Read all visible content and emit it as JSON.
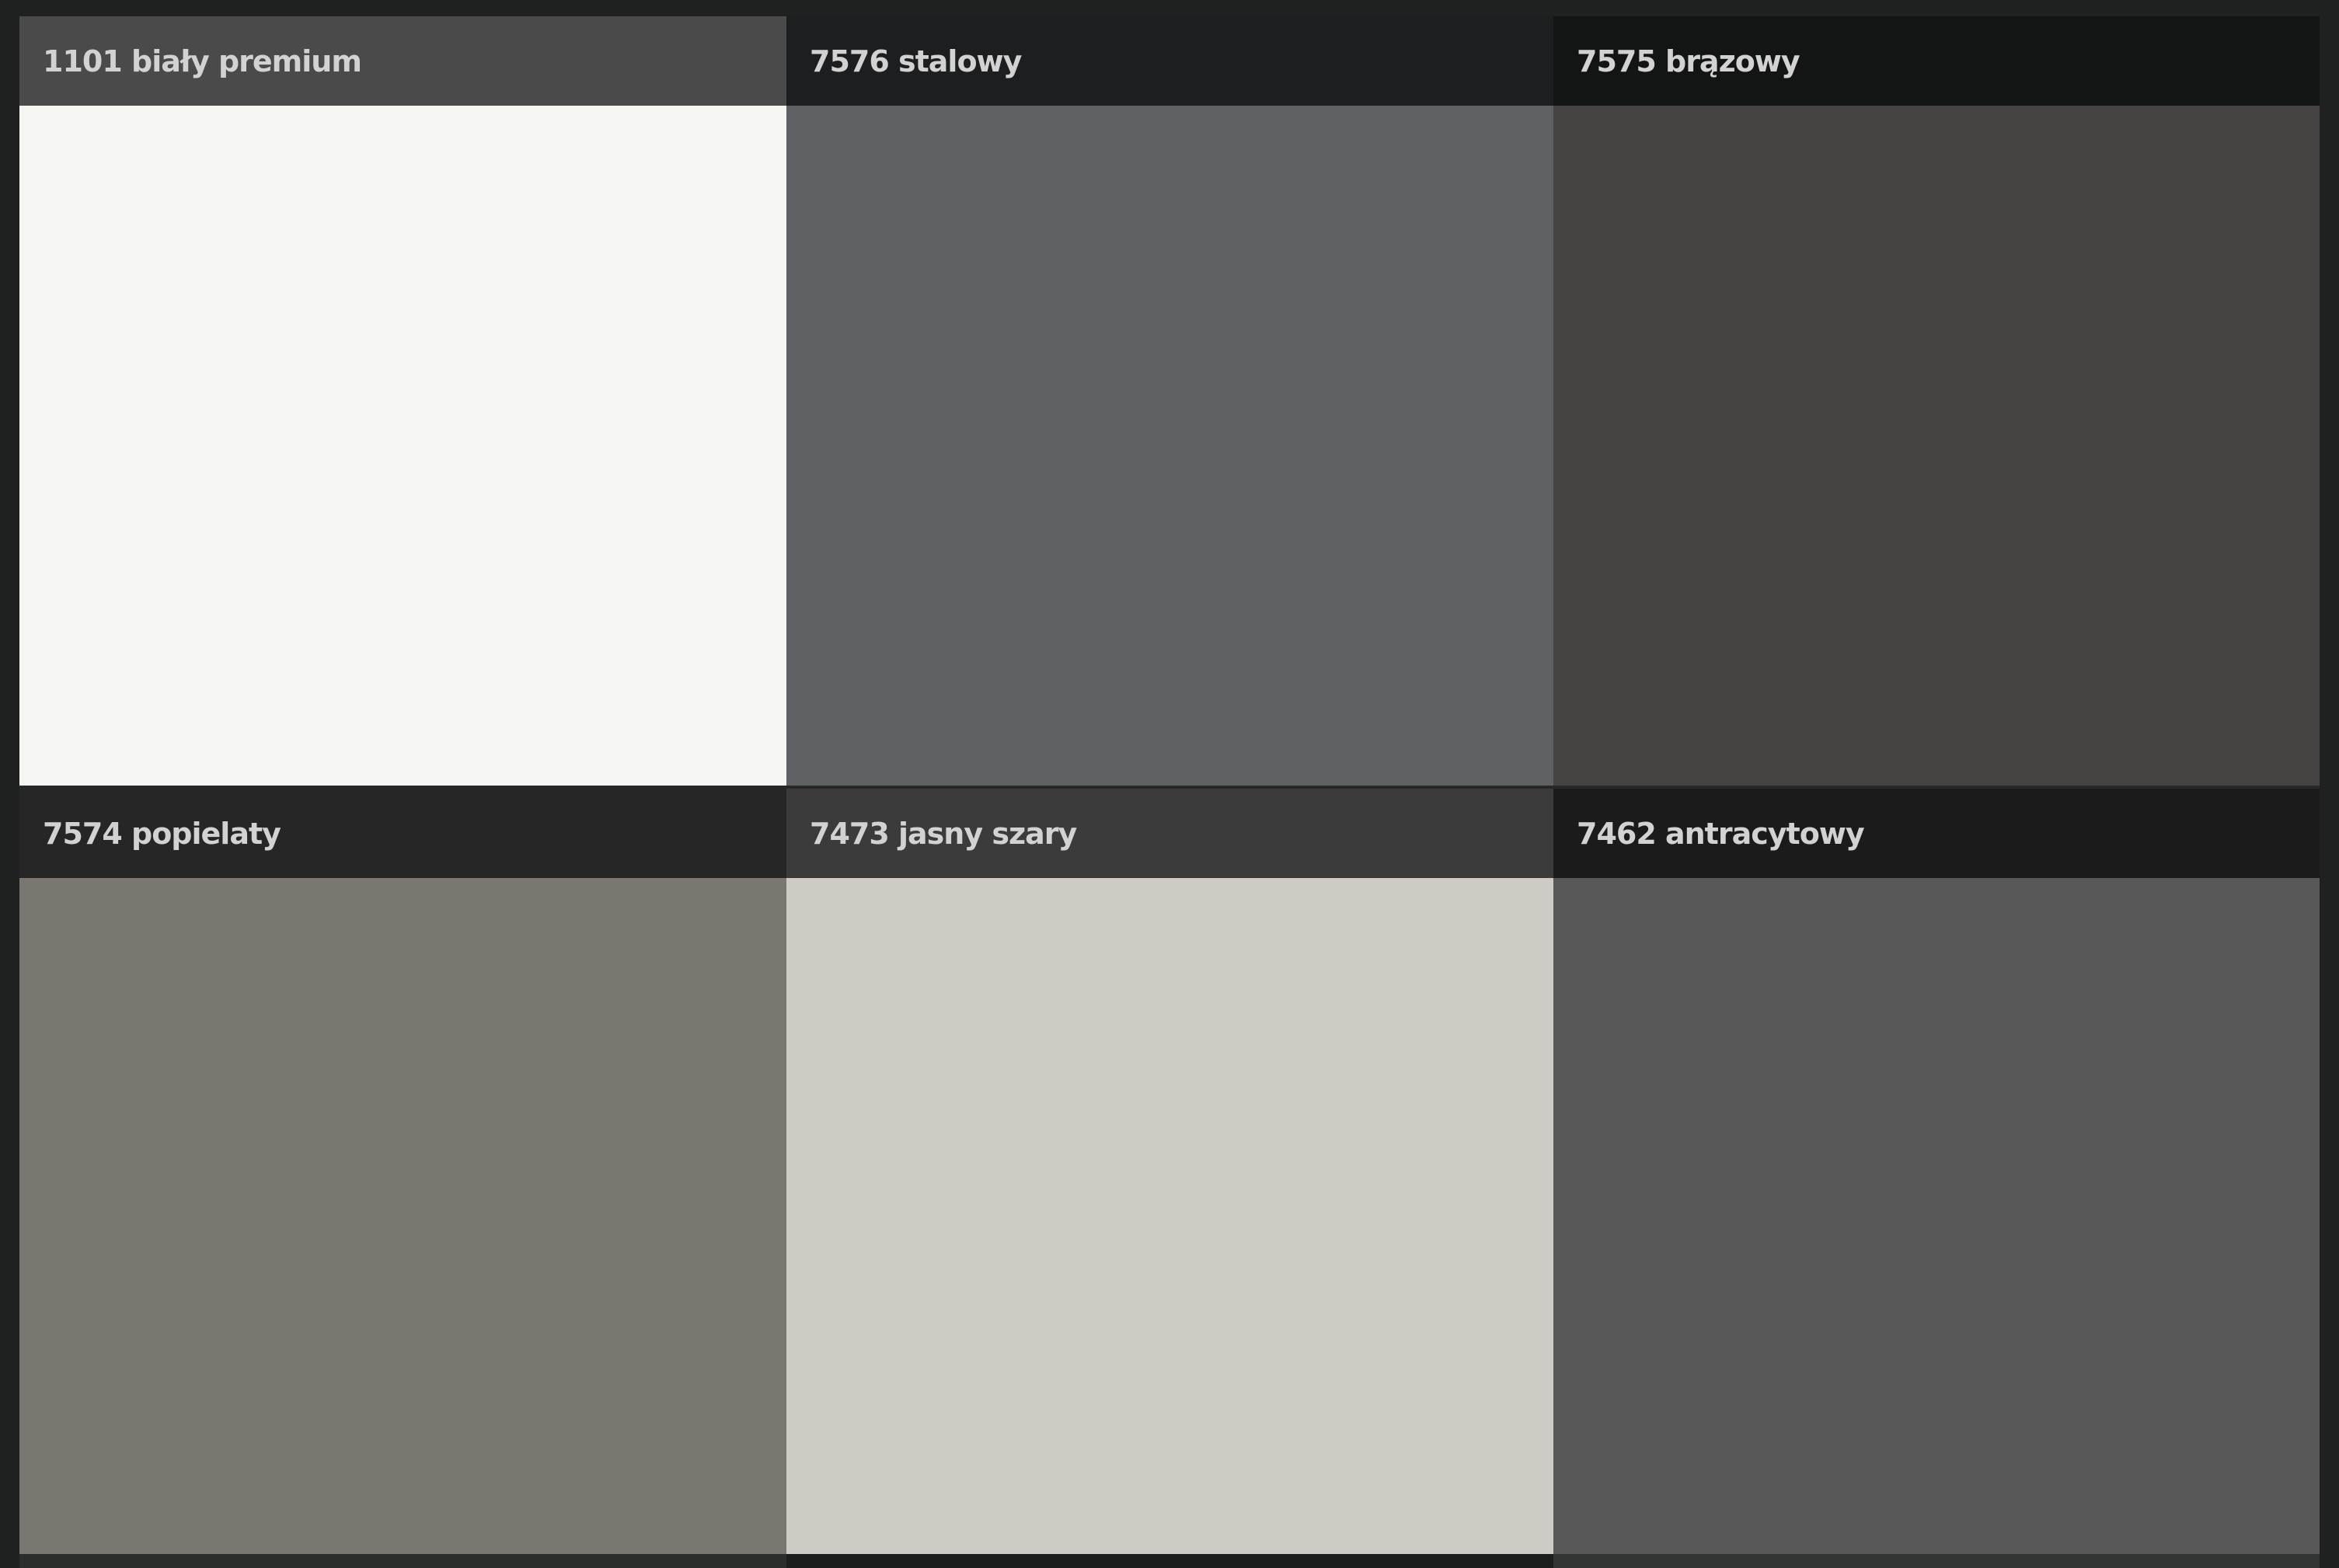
{
  "swatches": [
    {
      "label": "1101 biały premium",
      "header_color": "#4a4a4a",
      "color": "#f5f5f1"
    },
    {
      "label": "7576 stalowy",
      "header_color": "#1d1e1f",
      "color": "#5e6265"
    },
    {
      "label": "7575 brązowy",
      "header_color": "#131414",
      "color": "#474343"
    },
    {
      "label": "7574 popielaty",
      "header_color": "#262627",
      "color": "#7a7770"
    },
    {
      "label": "7473 jasny szary",
      "header_color": "#3b3b3c",
      "color": "#cecbc4"
    },
    {
      "label": "7462 antracytowy",
      "header_color": "#1b1b1c",
      "color": "#585858"
    }
  ],
  "background": "#1f2020"
}
